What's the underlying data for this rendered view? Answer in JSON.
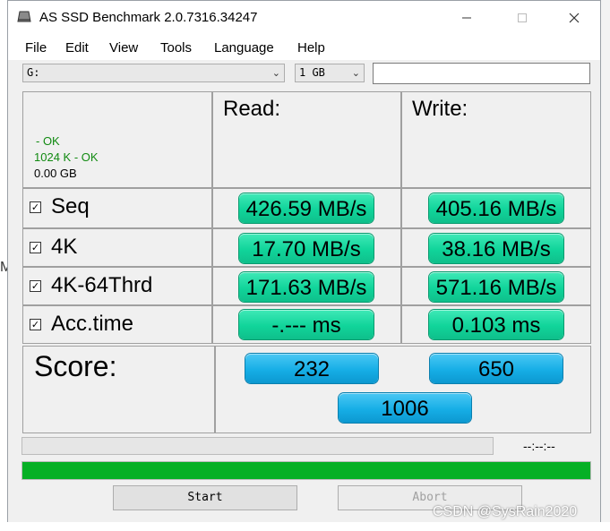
{
  "window": {
    "title": "AS SSD Benchmark 2.0.7316.34247"
  },
  "menu": [
    "File",
    "Edit",
    "View",
    "Tools",
    "Language",
    "Help"
  ],
  "controls": {
    "drive": "G:",
    "size": "1 GB",
    "textbox_value": ""
  },
  "info": {
    "line1": " - OK",
    "line2": "1024 K - OK",
    "line3": "0.00 GB"
  },
  "columns": {
    "read": "Read:",
    "write": "Write:"
  },
  "rows": [
    {
      "label": "Seq",
      "checked": true,
      "read": "426.59 MB/s",
      "write": "405.16 MB/s"
    },
    {
      "label": "4K",
      "checked": true,
      "read": "17.70 MB/s",
      "write": "38.16 MB/s"
    },
    {
      "label": "4K-64Thrd",
      "checked": true,
      "read": "171.63 MB/s",
      "write": "571.16 MB/s"
    },
    {
      "label": "Acc.time",
      "checked": true,
      "read": "-.--- ms",
      "write": "0.103 ms"
    }
  ],
  "score": {
    "label": "Score:",
    "read": "232",
    "write": "650",
    "total": "1006"
  },
  "progress": {
    "time": "--:--:--",
    "top_fraction": 0,
    "bottom_fraction": 1
  },
  "buttons": {
    "start": "Start",
    "abort": "Abort"
  },
  "watermark": "CSDN @SysRain2020",
  "colors": {
    "result_green": "#10d49a",
    "score_blue": "#16aee6",
    "progress_green": "#06b025"
  }
}
